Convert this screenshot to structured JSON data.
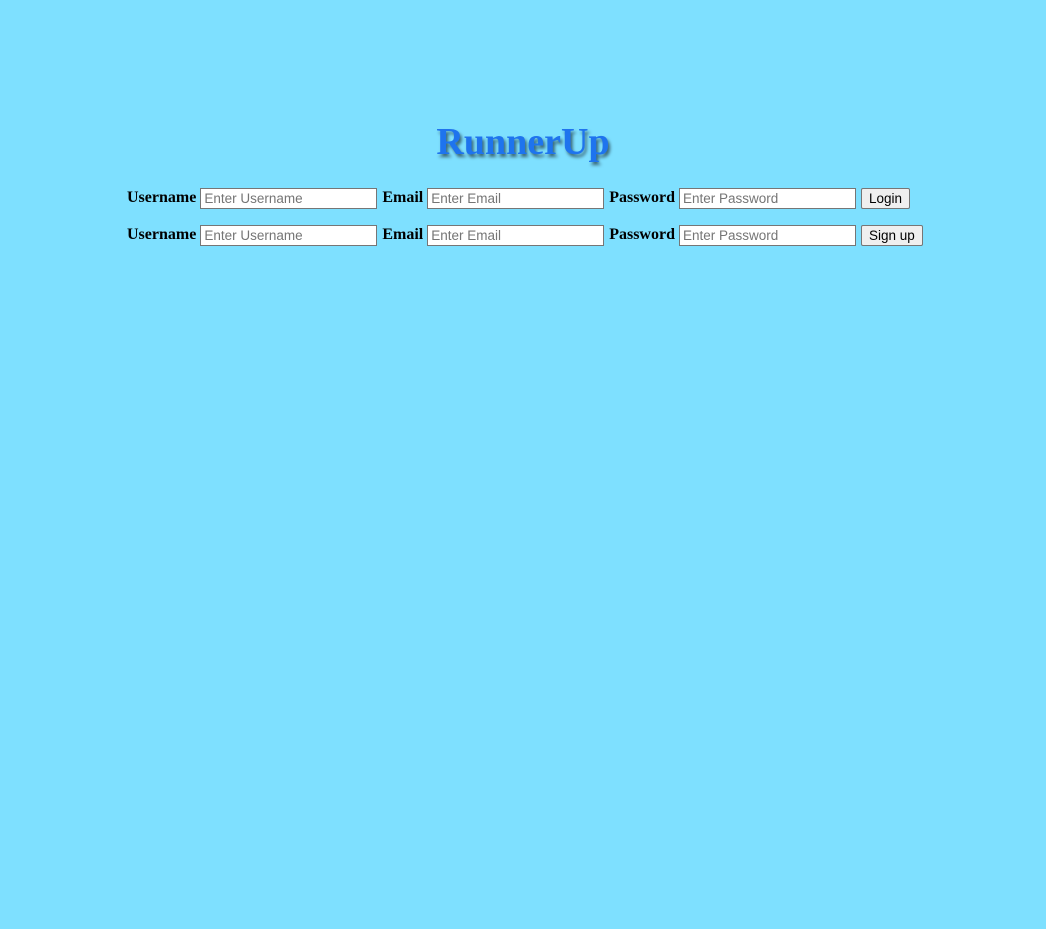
{
  "header": {
    "title": "RunnerUp"
  },
  "login_form": {
    "username_label": "Username",
    "username_placeholder": "Enter Username",
    "email_label": "Email",
    "email_placeholder": "Enter Email",
    "password_label": "Password",
    "password_placeholder": "Enter Password",
    "submit_label": "Login"
  },
  "signup_form": {
    "username_label": "Username",
    "username_placeholder": "Enter Username",
    "email_label": "Email",
    "email_placeholder": "Enter Email",
    "password_label": "Password",
    "password_placeholder": "Enter Password",
    "submit_label": "Sign up"
  },
  "colors": {
    "background": "#7ee0ff",
    "title": "#1e74ee"
  }
}
